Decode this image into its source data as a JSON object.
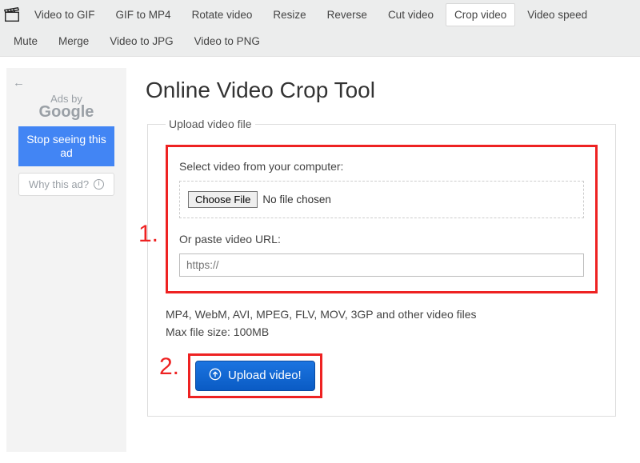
{
  "tabs": {
    "row1": [
      "Video to GIF",
      "GIF to MP4",
      "Rotate video",
      "Resize",
      "Reverse",
      "Cut video",
      "Crop video",
      "Video speed"
    ],
    "row2": [
      "Mute",
      "Merge",
      "Video to JPG",
      "Video to PNG"
    ],
    "active": "Crop video"
  },
  "sidebar": {
    "back_arrow": "←",
    "ads_by": "Ads by",
    "google": "Google",
    "stop_ad": "Stop seeing this ad",
    "why_ad": "Why this ad?",
    "info_glyph": "i"
  },
  "page": {
    "title": "Online Video Crop Tool",
    "upload_legend": "Upload video file",
    "select_label": "Select video from your computer:",
    "choose_file": "Choose File",
    "no_file": "No file chosen",
    "or_paste": "Or paste video URL:",
    "url_placeholder": "https://",
    "formats_note": "MP4, WebM, AVI, MPEG, FLV, MOV, 3GP and other video files",
    "max_size": "Max file size: 100MB",
    "upload_btn": "Upload video!",
    "step1": "1.",
    "step2": "2."
  }
}
